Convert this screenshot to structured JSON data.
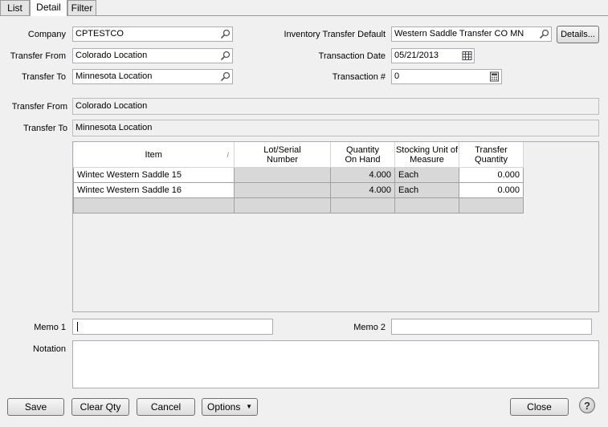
{
  "tabs": [
    {
      "label": "List"
    },
    {
      "label": "Detail"
    },
    {
      "label": "Filter"
    }
  ],
  "header": {
    "company_label": "Company",
    "company_value": "CPTESTCO",
    "transfer_from_label": "Transfer From",
    "transfer_from_value": "Colorado Location",
    "transfer_to_label": "Transfer To",
    "transfer_to_value": "Minnesota Location",
    "inv_default_label": "Inventory Transfer Default",
    "inv_default_value": "Western Saddle Transfer CO MN",
    "details_button": "Details...",
    "trans_date_label": "Transaction Date",
    "trans_date_value": "05/21/2013",
    "trans_num_label": "Transaction #",
    "trans_num_value": "0"
  },
  "summary": {
    "from_label": "Transfer From",
    "from_value": "Colorado Location",
    "to_label": "Transfer To",
    "to_value": "Minnesota Location"
  },
  "grid": {
    "columns": [
      "Item",
      "Lot/Serial Number",
      "Quantity On Hand",
      "Stocking Unit of Measure",
      "Transfer Quantity"
    ],
    "rows": [
      {
        "item": "Wintec Western Saddle 15",
        "lot": "",
        "qoh": "4.000",
        "uom": "Each",
        "qty": "0.000"
      },
      {
        "item": "Wintec Western Saddle 16",
        "lot": "",
        "qoh": "4.000",
        "uom": "Each",
        "qty": "0.000"
      }
    ]
  },
  "memo": {
    "memo1_label": "Memo 1",
    "memo1_value": "",
    "memo2_label": "Memo 2",
    "memo2_value": "",
    "notation_label": "Notation",
    "notation_value": ""
  },
  "footer": {
    "save": "Save",
    "clear_qty": "Clear Qty",
    "cancel": "Cancel",
    "options": "Options",
    "close": "Close",
    "help": "?"
  },
  "icons": [
    "search-icon",
    "calendar-icon",
    "calculator-icon",
    "dropdown-arrow-icon",
    "help-icon",
    "sort-icon"
  ]
}
